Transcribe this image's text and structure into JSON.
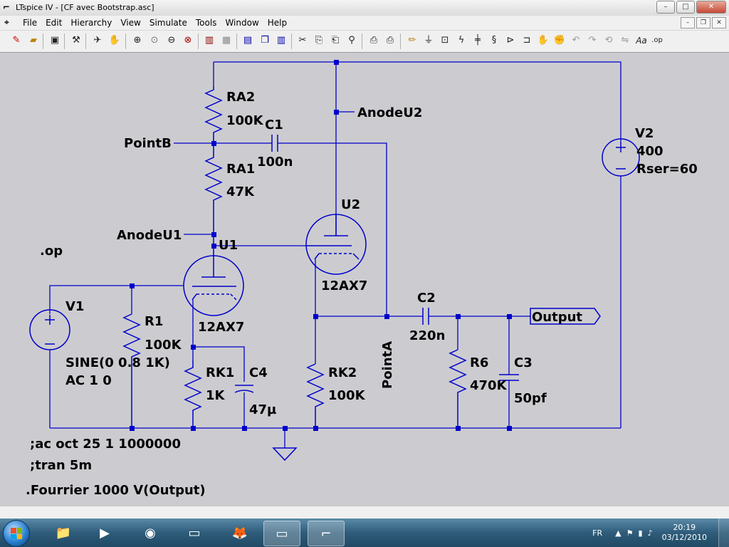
{
  "window": {
    "title": "LTspice IV - [CF avec Bootstrap.asc]",
    "buttons": {
      "minimize": "–",
      "maximize": "□",
      "close": "✕"
    }
  },
  "menubar": {
    "items": [
      "File",
      "Edit",
      "Hierarchy",
      "View",
      "Simulate",
      "Tools",
      "Window",
      "Help"
    ],
    "mdi_buttons": {
      "minimize": "–",
      "restore": "❐",
      "close": "✕"
    }
  },
  "toolbar": {
    "icons": [
      "new-schematic-icon",
      "open-icon",
      "save-icon",
      "control-panel-icon",
      "run-icon",
      "halt-icon",
      "zoom-in-icon",
      "zoom-pan-icon",
      "zoom-out-icon",
      "zoom-fit-icon",
      "autoscale-icon",
      "grid-icon",
      "tile-horizontal-icon",
      "cascade-icon",
      "tile-vertical-icon",
      "cut-icon",
      "copy-icon",
      "paste-icon",
      "find-icon",
      "print-setup-icon",
      "print-icon",
      "wire-icon",
      "ground-icon",
      "label-net-icon",
      "resistor-icon",
      "capacitor-icon",
      "inductor-icon",
      "diode-icon",
      "component-icon",
      "move-icon",
      "drag-icon",
      "undo-icon",
      "redo-icon",
      "rotate-icon",
      "mirror-icon",
      "text-icon",
      "spice-directive-icon"
    ],
    "text_labels": {
      "text": "Aa",
      "directive": ".op"
    }
  },
  "schematic": {
    "labels": {
      "RA2": "RA2",
      "RA2_val": "100K",
      "C1": "C1",
      "C1_val": "100n",
      "RA1": "RA1",
      "RA1_val": "47K",
      "PointB": "PointB",
      "AnodeU2": "AnodeU2",
      "AnodeU1": "AnodeU1",
      "U1": "U1",
      "U1_model": "12AX7",
      "U2": "U2",
      "U2_model": "12AX7",
      "V2": "V2",
      "V2_val": "400",
      "V2_rser": "Rser=60",
      "op": ".op",
      "V1": "V1",
      "V1_sine": "SINE(0 0.8 1K)",
      "V1_ac": "AC 1 0",
      "R1": "R1",
      "R1_val": "100K",
      "RK1": "RK1",
      "RK1_val": "1K",
      "C4": "C4",
      "C4_val": "47µ",
      "RK2": "RK2",
      "RK2_val": "100K",
      "PointA": "PointA",
      "C2": "C2",
      "C2_val": "220n",
      "R6": "R6",
      "R6_val": "470K",
      "C3": "C3",
      "C3_val": "50pf",
      "Output": "Output",
      "ac_directive": ";ac oct 25 1 1000000",
      "tran_directive": ";tran 5m",
      "fourier_directive": ".Fourrier 1000 V(Output)"
    }
  },
  "taskbar": {
    "language": "FR",
    "time": "20:19",
    "date": "03/12/2010"
  },
  "colors": {
    "wire": "#0000cc",
    "canvas": "#ccccd0",
    "taskbar": "#2e5c7a"
  }
}
